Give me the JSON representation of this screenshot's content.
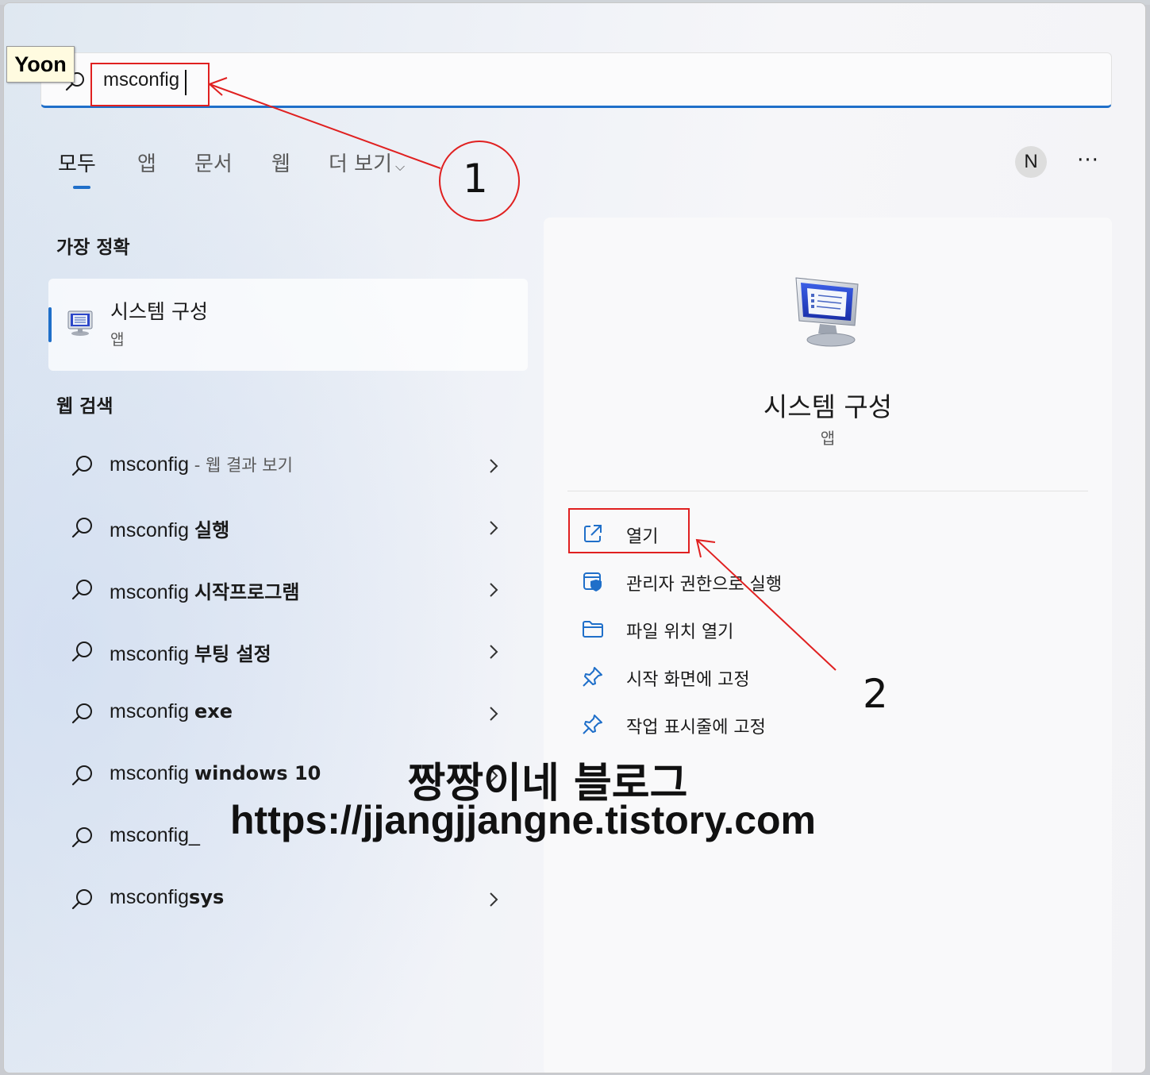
{
  "search": {
    "value": "msconfig",
    "user_label": "Yoon"
  },
  "tabs": [
    {
      "label": "모두"
    },
    {
      "label": "앱"
    },
    {
      "label": "문서"
    },
    {
      "label": "웹"
    },
    {
      "label": "더 보기"
    }
  ],
  "header": {
    "avatar_initial": "N",
    "more_label": "···"
  },
  "best_match": {
    "heading": "가장 정확",
    "title": "시스템 구성",
    "subtitle": "앱"
  },
  "web_search": {
    "heading": "웹 검색",
    "items": [
      {
        "query": "msconfig",
        "suffix": " - 웹 결과 보기",
        "bold": ""
      },
      {
        "query": "msconfig ",
        "suffix": "",
        "bold": "실행"
      },
      {
        "query": "msconfig ",
        "suffix": "",
        "bold": "시작프로그램"
      },
      {
        "query": "msconfig ",
        "suffix": "",
        "bold": "부팅 설정"
      },
      {
        "query": "msconfig ",
        "suffix": "",
        "bold": "exe"
      },
      {
        "query": "msconfig ",
        "suffix": "",
        "bold": "windows 10"
      },
      {
        "query": "msconfig_",
        "suffix": "",
        "bold": ""
      },
      {
        "query": "msconfig",
        "suffix": "",
        "bold": "sys"
      }
    ]
  },
  "detail": {
    "title": "시스템 구성",
    "subtitle": "앱",
    "actions": [
      {
        "label": "열기",
        "icon": "open-external-icon"
      },
      {
        "label": "관리자 권한으로 실행",
        "icon": "shield-icon"
      },
      {
        "label": "파일 위치 열기",
        "icon": "folder-icon"
      },
      {
        "label": "시작 화면에 고정",
        "icon": "pin-icon"
      },
      {
        "label": "작업 표시줄에 고정",
        "icon": "pin-icon"
      }
    ]
  },
  "annotations": {
    "step1": "1",
    "step2": "2",
    "watermark_title": "짱짱이네 블로그",
    "watermark_url": "https://jjangjjangne.tistory.com"
  },
  "colors": {
    "accent": "#1f6fc9",
    "annotation_red": "#e02020"
  }
}
